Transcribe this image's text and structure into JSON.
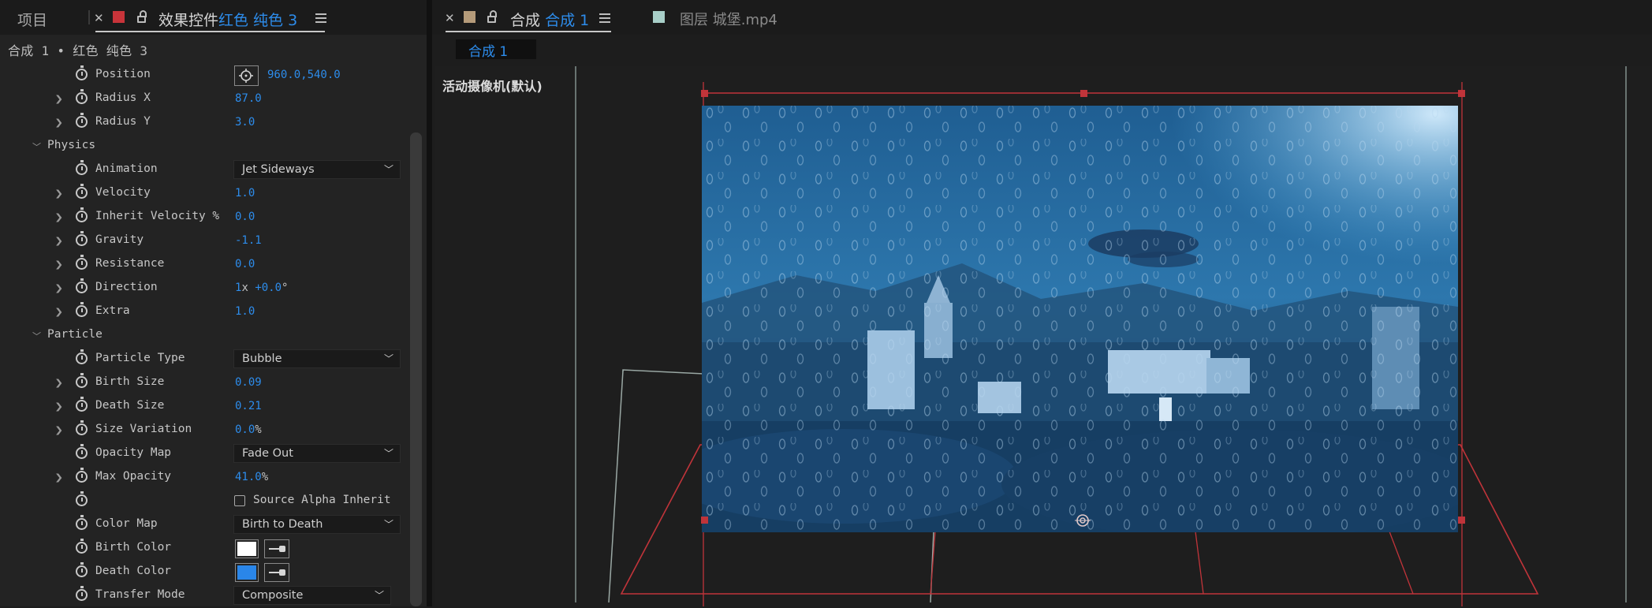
{
  "left_tabs": {
    "project_label": "项目",
    "effect_controls_label": "效果控件",
    "effect_controls_layer": "红色 纯色 3",
    "layer_color": "#d23a3a"
  },
  "breadcrumb": "合成 1 • 红色 纯色 3",
  "props": {
    "position_label": "Position",
    "position_value": "960.0,540.0",
    "radius_x_label": "Radius X",
    "radius_x_value": "87.0",
    "radius_y_label": "Radius Y",
    "radius_y_value": "3.0",
    "physics_label": "Physics",
    "animation_label": "Animation",
    "animation_value": "Jet Sideways",
    "velocity_label": "Velocity",
    "velocity_value": "1.0",
    "inherit_velocity_label": "Inherit Velocity %",
    "inherit_velocity_value": "0.0",
    "gravity_label": "Gravity",
    "gravity_value": "-1.1",
    "resistance_label": "Resistance",
    "resistance_value": "0.0",
    "direction_label": "Direction",
    "direction_turns": "1",
    "direction_x": "x",
    "direction_value": "+0.0",
    "direction_unit": "°",
    "extra_label": "Extra",
    "extra_value": "1.0",
    "particle_label": "Particle",
    "particle_type_label": "Particle Type",
    "particle_type_value": "Bubble",
    "birth_size_label": "Birth Size",
    "birth_size_value": "0.09",
    "death_size_label": "Death Size",
    "death_size_value": "0.21",
    "size_variation_label": "Size Variation",
    "size_variation_value": "0.0",
    "size_variation_unit": "%",
    "opacity_map_label": "Opacity Map",
    "opacity_map_value": "Fade Out",
    "max_opacity_label": "Max Opacity",
    "max_opacity_value": "41.0",
    "max_opacity_unit": "%",
    "source_alpha_label": "Source Alpha Inherit",
    "color_map_label": "Color Map",
    "color_map_value": "Birth to Death",
    "birth_color_label": "Birth Color",
    "birth_color": "#ffffff",
    "death_color_label": "Death Color",
    "death_color": "#2a86e9",
    "transfer_mode_label": "Transfer Mode",
    "transfer_mode_value": "Composite"
  },
  "right_tabs": {
    "comp_prefix": "合成",
    "comp_name": "合成 1",
    "layer_tab": "图层 城堡.mp4",
    "comp_color": "#b59b7a",
    "layer_color": "#a8cfc8",
    "sub_tab": "合成 1"
  },
  "viewer": {
    "camera_label": "活动摄像机(默认)"
  }
}
